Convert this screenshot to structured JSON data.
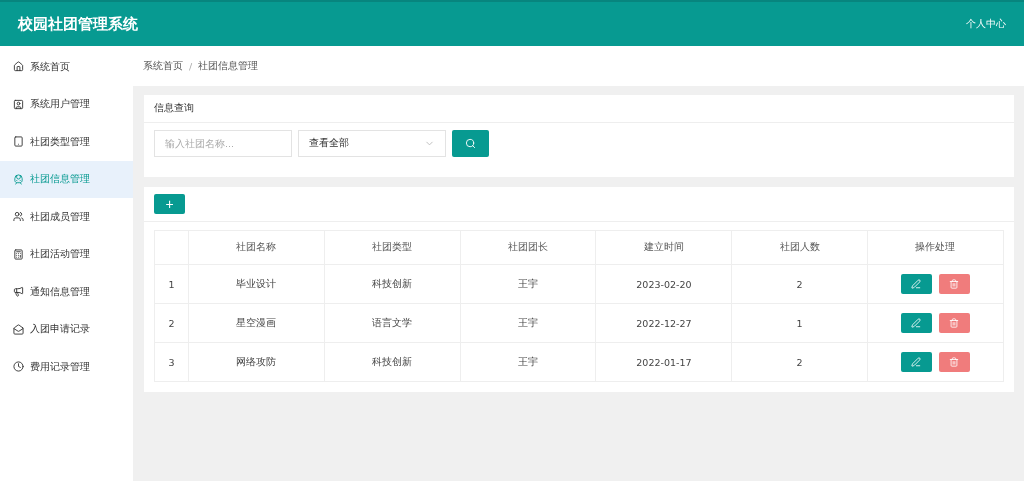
{
  "header": {
    "title": "校园社团管理系统",
    "user_menu": "个人中心"
  },
  "sidebar": {
    "items": [
      {
        "label": "系统首页",
        "selected": false
      },
      {
        "label": "系统用户管理",
        "selected": false
      },
      {
        "label": "社团类型管理",
        "selected": false
      },
      {
        "label": "社团信息管理",
        "selected": true
      },
      {
        "label": "社团成员管理",
        "selected": false
      },
      {
        "label": "社团活动管理",
        "selected": false
      },
      {
        "label": "通知信息管理",
        "selected": false
      },
      {
        "label": "入团申请记录",
        "selected": false
      },
      {
        "label": "费用记录管理",
        "selected": false
      }
    ]
  },
  "breadcrumb": {
    "items": [
      "系统首页",
      "社团信息管理"
    ],
    "separator": "/"
  },
  "query": {
    "title": "信息查询",
    "name_field": {
      "placeholder": "输入社团名称..."
    },
    "type_select": {
      "value": "查看全部"
    }
  },
  "add_button": "+",
  "table": {
    "columns": [
      "",
      "社团名称",
      "社团类型",
      "社团团长",
      "建立时间",
      "社团人数",
      "操作处理"
    ],
    "rows": [
      [
        "1",
        "毕业设计",
        "科技创新",
        "王宇",
        "2023-02-20",
        "2"
      ],
      [
        "2",
        "星空漫画",
        "语言文学",
        "王宇",
        "2022-12-27",
        "1"
      ],
      [
        "3",
        "网络攻防",
        "科技创新",
        "王宇",
        "2022-01-17",
        "2"
      ]
    ]
  }
}
